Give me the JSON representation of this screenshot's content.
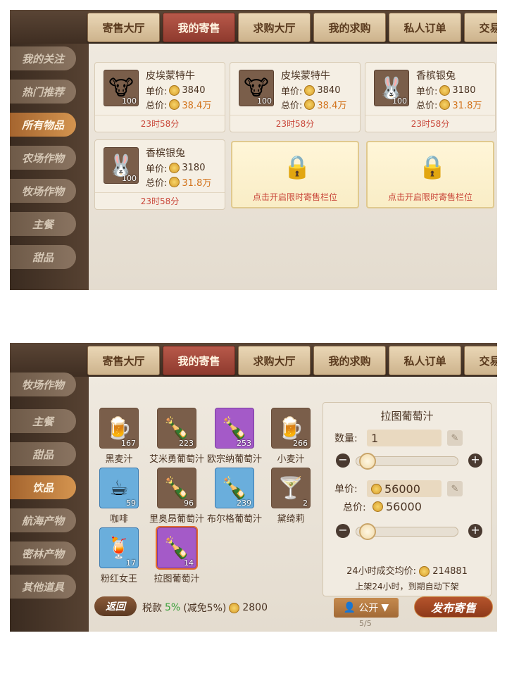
{
  "tabs": [
    "寄售大厅",
    "我的寄售",
    "求购大厅",
    "我的求购",
    "私人订单",
    "交易记录"
  ],
  "active_tab": "我的寄售",
  "screen1": {
    "sidebar": [
      "我的关注",
      "热门推荐",
      "所有物品",
      "农场作物",
      "牧场作物",
      "主餐",
      "甜品"
    ],
    "active_item": "所有物品",
    "listings": [
      {
        "name": "皮埃蒙特牛",
        "icon": "cow-icon",
        "qty": "100",
        "unit_label": "单价:",
        "unit_price": "3840",
        "total_label": "总价:",
        "total_price": "38.4万",
        "timer": "23时58分"
      },
      {
        "name": "皮埃蒙特牛",
        "icon": "cow-icon",
        "qty": "100",
        "unit_label": "单价:",
        "unit_price": "3840",
        "total_label": "总价:",
        "total_price": "38.4万",
        "timer": "23时58分"
      },
      {
        "name": "香槟银兔",
        "icon": "rabbit-icon",
        "qty": "100",
        "unit_label": "单价:",
        "unit_price": "3180",
        "total_label": "总价:",
        "total_price": "31.8万",
        "timer": "23时58分"
      },
      {
        "name": "香槟银兔",
        "icon": "rabbit-icon",
        "qty": "100",
        "unit_label": "单价:",
        "unit_price": "3180",
        "total_label": "总价:",
        "total_price": "31.8万",
        "timer": "23时58分"
      }
    ],
    "locked_slots": [
      "点击开启限时寄售栏位",
      "点击开启限时寄售栏位"
    ]
  },
  "screen2": {
    "sidebar": [
      "牧场作物",
      "主餐",
      "甜品",
      "饮品",
      "航海产物",
      "密林产物",
      "其他道具"
    ],
    "active_item": "饮品",
    "drinks": [
      {
        "name": "黑麦汁",
        "qty": "167",
        "icon": "beer-mug-icon",
        "bg": "brown"
      },
      {
        "name": "艾米勇葡萄汁",
        "qty": "223",
        "icon": "wine-bottle-icon",
        "bg": "brown"
      },
      {
        "name": "欧宗纳葡萄汁",
        "qty": "253",
        "icon": "wine-bottle-icon",
        "bg": "purple"
      },
      {
        "name": "小麦汁",
        "qty": "266",
        "icon": "beer-mug-icon",
        "bg": "brown"
      },
      {
        "name": "咖啡",
        "qty": "59",
        "icon": "coffee-cup-icon",
        "bg": "blue"
      },
      {
        "name": "里奥昂葡萄汁",
        "qty": "96",
        "icon": "wine-bottle-icon",
        "bg": "brown"
      },
      {
        "name": "布尔格葡萄汁",
        "qty": "239",
        "icon": "wine-bottle-icon",
        "bg": "blue"
      },
      {
        "name": "黛绮莉",
        "qty": "2",
        "icon": "cocktail-glass-icon",
        "bg": "brown"
      },
      {
        "name": "粉红女王",
        "qty": "17",
        "icon": "cocktail-glass-icon",
        "bg": "blue"
      },
      {
        "name": "拉图葡萄汁",
        "qty": "14",
        "icon": "wine-bottle-icon",
        "bg": "purple"
      }
    ],
    "selected_drink": "拉图葡萄汁",
    "detail": {
      "title": "拉图葡萄汁",
      "quantity_label": "数量:",
      "quantity": "1",
      "unit_price_label": "单价:",
      "unit_price": "56000",
      "total_label": "总价:",
      "total_price": "56000",
      "avg_label": "24小时成交均价:",
      "avg_price": "214881",
      "note": "上架24小时，到期自动下架"
    },
    "footer": {
      "back": "返回",
      "tax_label": "税款",
      "tax_rate": "5%",
      "tax_discount": "(减免5%)",
      "tax_amount": "2800",
      "public_button": "公开",
      "publish_button": "发布寄售",
      "page": "5/5"
    }
  }
}
